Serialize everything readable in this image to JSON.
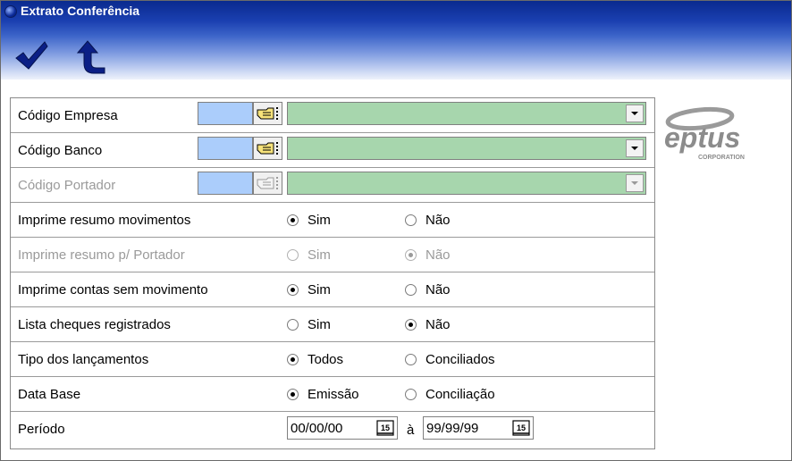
{
  "window": {
    "title": "Extrato Conferência"
  },
  "toolbar": {
    "confirm": "confirm-check",
    "back": "back-arrow"
  },
  "logo": {
    "text": "eptus",
    "subtext": "CORPORATION"
  },
  "fields": {
    "codigo_empresa": "Código Empresa",
    "codigo_banco": "Código Banco",
    "codigo_portador": "Código Portador"
  },
  "rows": {
    "resumo_movimentos": {
      "label": "Imprime resumo movimentos",
      "opt1": "Sim",
      "opt2": "Não",
      "selected": "Sim"
    },
    "resumo_portador": {
      "label": "Imprime resumo p/ Portador",
      "opt1": "Sim",
      "opt2": "Não",
      "selected": "Não"
    },
    "contas_sem_mov": {
      "label": "Imprime contas sem movimento",
      "opt1": "Sim",
      "opt2": "Não",
      "selected": "Sim"
    },
    "cheques_registrados": {
      "label": "Lista cheques registrados",
      "opt1": "Sim",
      "opt2": "Não",
      "selected": "Não"
    },
    "tipo_lancamentos": {
      "label": "Tipo dos lançamentos",
      "opt1": "Todos",
      "opt2": "Conciliados",
      "selected": "Todos"
    },
    "data_base": {
      "label": "Data Base",
      "opt1": "Emissão",
      "opt2": "Conciliação",
      "selected": "Emissão"
    }
  },
  "periodo": {
    "label": "Período",
    "from": "00/00/00",
    "to": "99/99/99",
    "between": "à",
    "cal_label": "15"
  }
}
